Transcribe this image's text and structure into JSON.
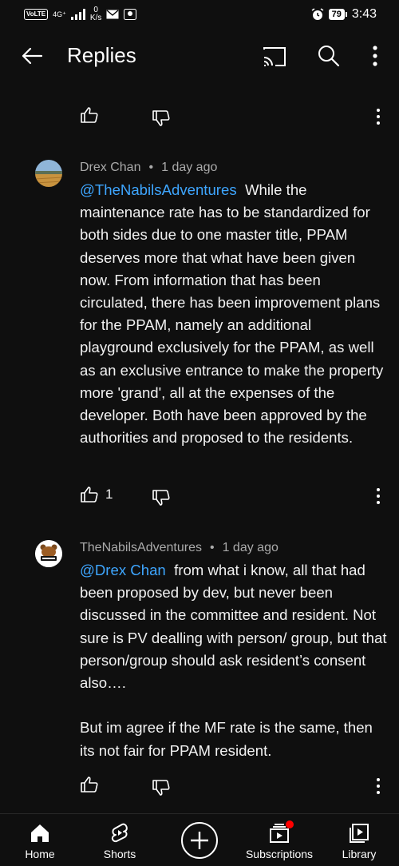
{
  "status_bar": {
    "volte": "VoLTE",
    "network": "4G⁺",
    "speed_value": "0",
    "speed_unit": "K/s",
    "battery": "79",
    "time": "3:43"
  },
  "header": {
    "title": "Replies"
  },
  "comments": [
    {
      "author": "Drex Chan",
      "time": "1 day ago",
      "mention": "@TheNabilsAdventures",
      "text": "While the maintenance rate has to be standardized for both sides due to one master title, PPAM deserves more that what have been given now. From information that has been circulated, there has been improvement plans for the PPAM, namely an additional playground exclusively for the PPAM, as well as an exclusive entrance to make the property more 'grand', all at the expenses of the developer. Both have been approved by the authorities and proposed to the residents.",
      "likes": "1"
    },
    {
      "author": "TheNabilsAdventures",
      "time": "1 day ago",
      "mention": "@Drex Chan",
      "text": "from what i know, all that had been proposed by dev, but never been discussed in the committee and resident. Not sure is PV dealling with person/ group, but that person/group should ask resident’s consent also….\n\nBut im agree if the MF rate is the same, then its not fair for PPAM resident.",
      "likes": ""
    }
  ],
  "bottom_nav": {
    "home": "Home",
    "shorts": "Shorts",
    "subscriptions": "Subscriptions",
    "library": "Library"
  },
  "colors": {
    "background": "#0f0f0f",
    "mention": "#3ea6ff",
    "meta": "#aaaaaa",
    "notification": "#ff0000"
  }
}
